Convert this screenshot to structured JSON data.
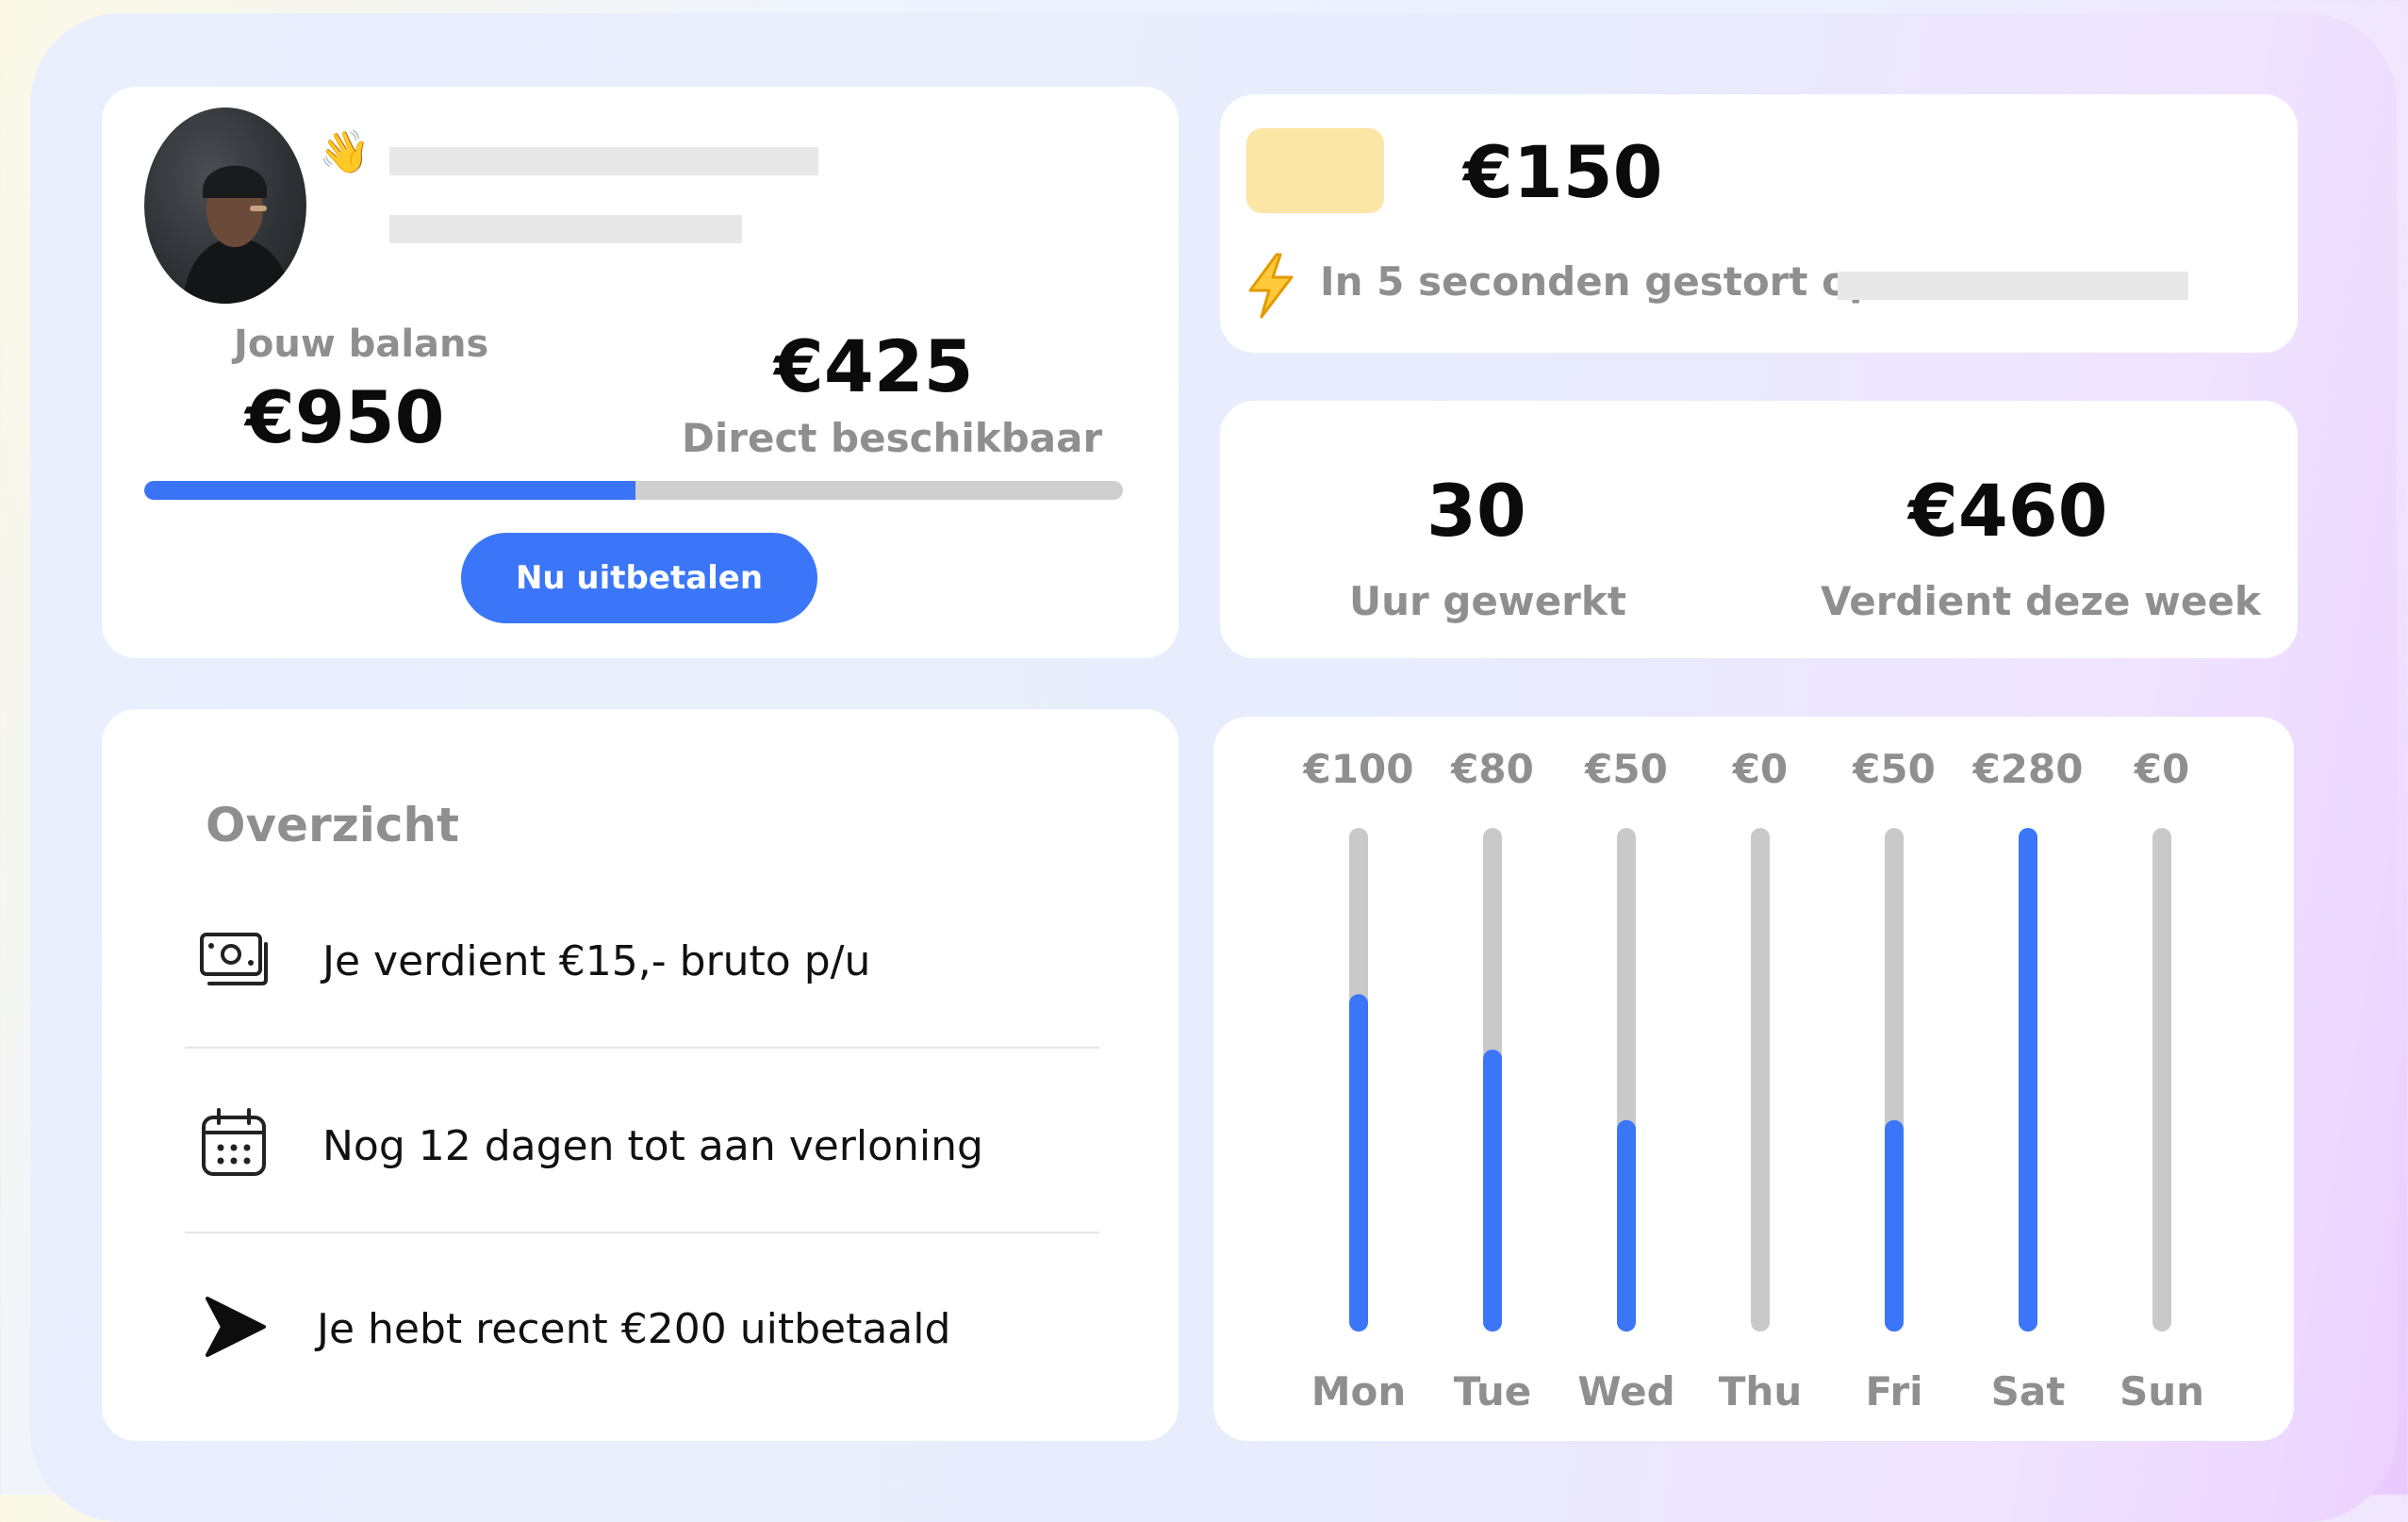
{
  "profile": {
    "wave_emoji": "👋",
    "balance_label": "Jouw balans",
    "balance_value": "€950",
    "available_value": "€425",
    "available_label": "Direct beschikbaar",
    "available_fraction": 0.502,
    "payout_button": "Nu uitbetalen"
  },
  "transfer": {
    "amount": "€150",
    "status_text": "In 5 seconden gestort op"
  },
  "stats": {
    "hours_value": "30",
    "hours_label": "Uur gewerkt",
    "earned_value": "€460",
    "earned_label": "Verdient deze week"
  },
  "overview": {
    "title": "Overzicht",
    "items": [
      {
        "icon": "money-icon",
        "text": "Je verdient €15,- bruto p/u"
      },
      {
        "icon": "calendar-icon",
        "text": "Nog 12 dagen tot aan verloning"
      },
      {
        "icon": "send-icon",
        "text": "Je hebt recent €200 uitbetaald"
      }
    ]
  },
  "colors": {
    "accent": "#3a76f7",
    "track": "#c9c9c9",
    "label_grey": "#8f8f8f",
    "highlight_yellow": "#fbe6a6"
  },
  "chart_data": {
    "type": "bar",
    "categories": [
      "Mon",
      "Tue",
      "Wed",
      "Thu",
      "Fri",
      "Sat",
      "Sun"
    ],
    "values": [
      100,
      80,
      50,
      0,
      50,
      280,
      0
    ],
    "fill_fraction": [
      0.67,
      0.56,
      0.42,
      0,
      0.42,
      1.0,
      0
    ],
    "labels": [
      "€100",
      "€80",
      "€50",
      "€0",
      "€50",
      "€280",
      "€0"
    ],
    "orientation": "vertical",
    "grid": false
  }
}
